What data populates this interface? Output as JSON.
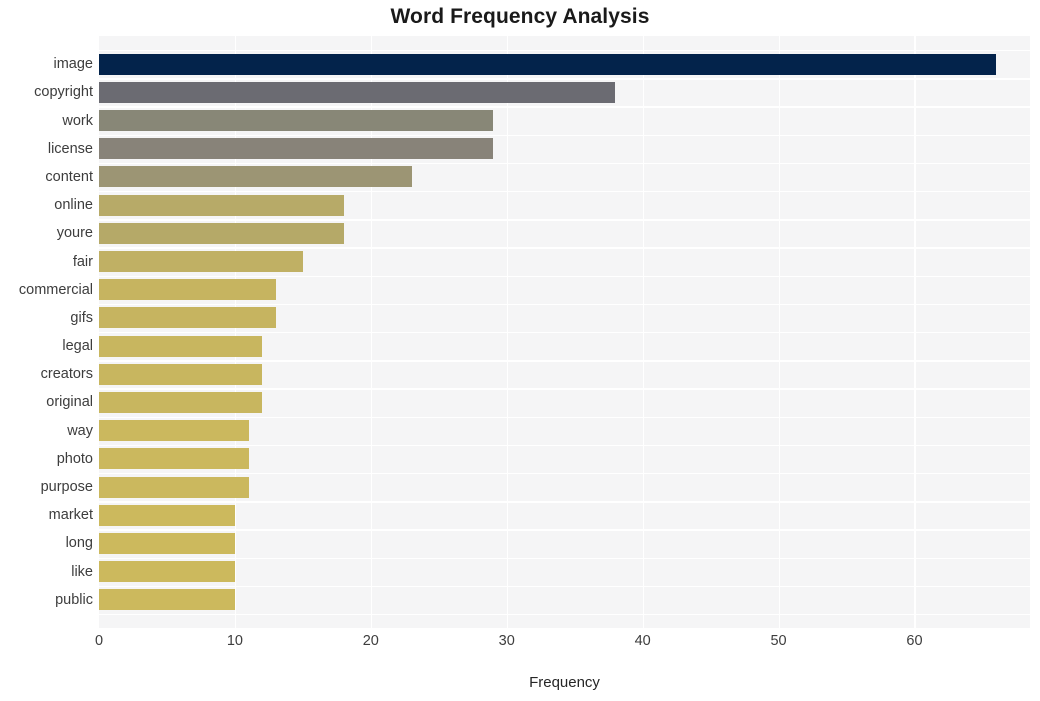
{
  "chart_data": {
    "type": "bar",
    "orientation": "horizontal",
    "title": "Word Frequency Analysis",
    "xlabel": "Frequency",
    "ylabel": "",
    "categories": [
      "image",
      "copyright",
      "work",
      "license",
      "content",
      "online",
      "youre",
      "fair",
      "commercial",
      "gifs",
      "legal",
      "creators",
      "original",
      "way",
      "photo",
      "purpose",
      "market",
      "long",
      "like",
      "public"
    ],
    "values": [
      66,
      38,
      29,
      29,
      23,
      18,
      18,
      15,
      13,
      13,
      12,
      12,
      12,
      11,
      11,
      11,
      10,
      10,
      10,
      10
    ],
    "bar_colors": [
      "#03234b",
      "#6b6b72",
      "#888777",
      "#888379",
      "#9c9574",
      "#b7aa68",
      "#b5a968",
      "#c0b064",
      "#c6b460",
      "#c6b460",
      "#c8b65f",
      "#c8b65f",
      "#c8b65f",
      "#cbb85e",
      "#cbb85e",
      "#cbb85e",
      "#ccb95d",
      "#ccb95d",
      "#ccb95d",
      "#ccb95d"
    ],
    "xticks": [
      0,
      10,
      20,
      30,
      40,
      50,
      60
    ],
    "xtick_labels": [
      "0",
      "10",
      "20",
      "30",
      "40",
      "50",
      "60"
    ],
    "xlim": [
      0,
      68.5
    ],
    "grid": true,
    "grid_color": "#ffffff",
    "plot_background": "#f5f5f6",
    "figure_background": "#ffffff",
    "legend": null,
    "legend_position": "none"
  }
}
